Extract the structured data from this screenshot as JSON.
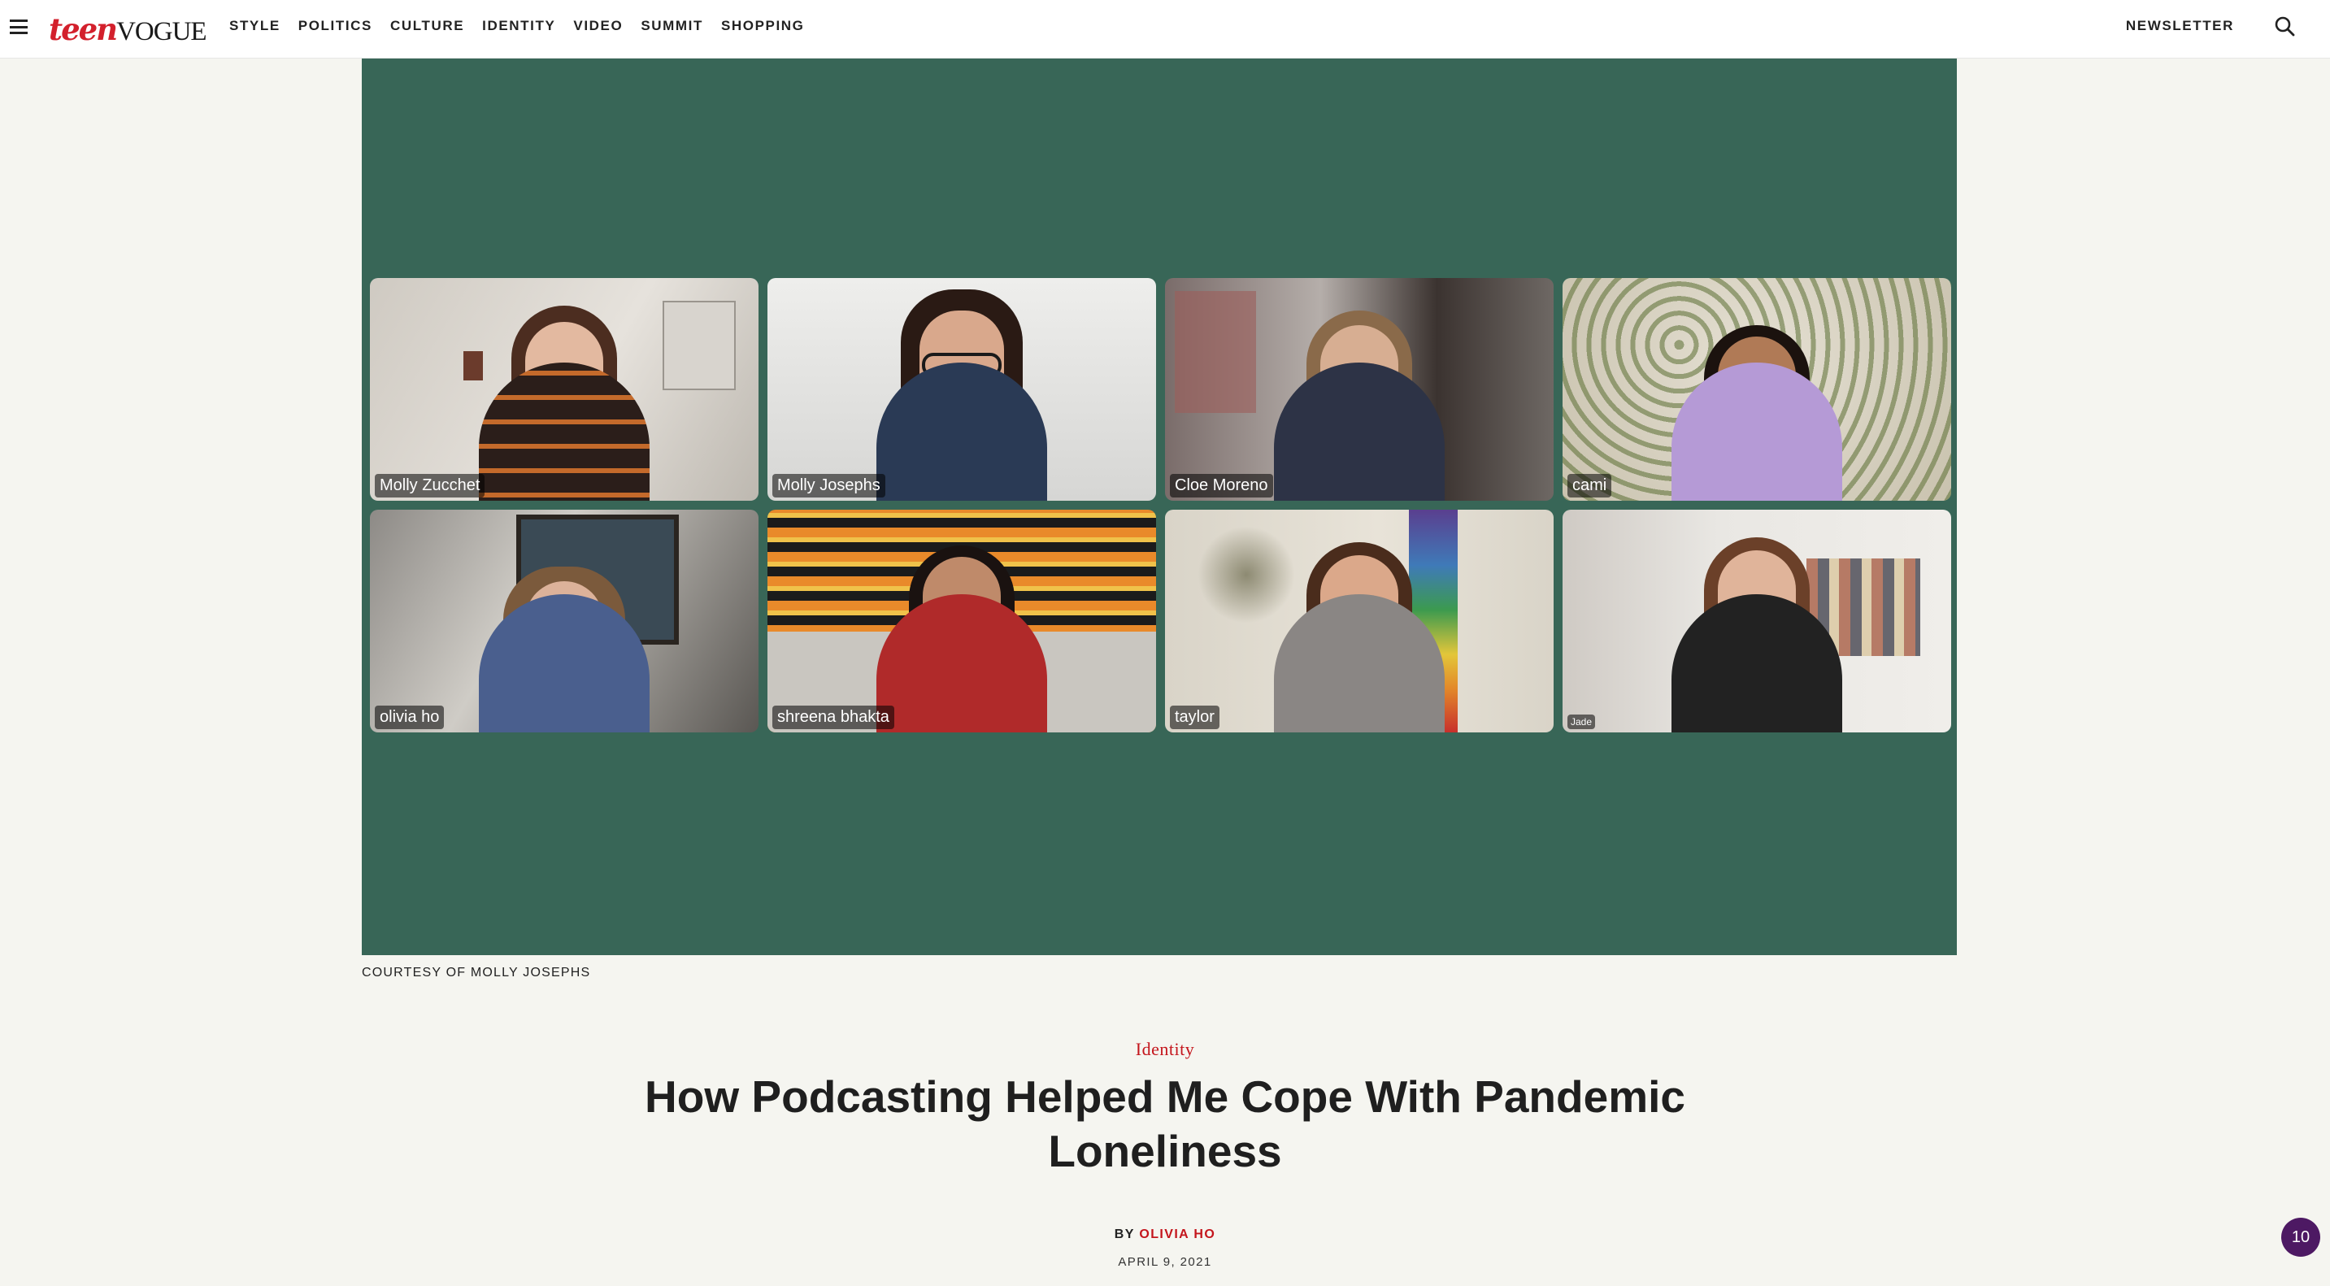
{
  "header": {
    "logo_teen": "teen",
    "logo_vogue": "VOGUE",
    "nav": [
      "STYLE",
      "POLITICS",
      "CULTURE",
      "IDENTITY",
      "VIDEO",
      "SUMMIT",
      "SHOPPING"
    ],
    "newsletter": "NEWSLETTER",
    "menu_icon": "hamburger-menu-icon",
    "search_icon": "search-icon"
  },
  "hero": {
    "background_color": "#386657",
    "participants": [
      "Molly Zucchet",
      "Molly Josephs",
      "Cloe Moreno",
      "cami",
      "olivia ho",
      "shreena bhakta",
      "taylor",
      "Jade"
    ],
    "credit": "COURTESY OF MOLLY JOSEPHS"
  },
  "article": {
    "rubric": "Identity",
    "headline": "How Podcasting Helped Me Cope With Pandemic Loneliness",
    "byline_prefix": "BY",
    "author": "OLIVIA HO",
    "date": "APRIL 9, 2021"
  },
  "badge": {
    "count": "10"
  },
  "colors": {
    "accent_red": "#c4151c",
    "badge_purple": "#4d1963"
  }
}
